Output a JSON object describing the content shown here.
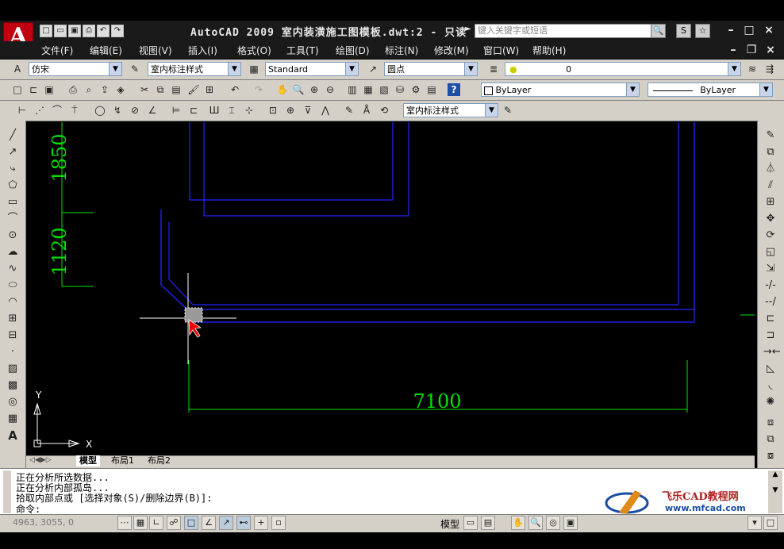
{
  "window": {
    "title": "AutoCAD 2009 室内装潢施工图模板.dwt:2 - 只读",
    "search_placeholder": "键入关键字或短语",
    "logo": "A"
  },
  "menu": [
    "文件(F)",
    "编辑(E)",
    "视图(V)",
    "插入(I)",
    "格式(O)",
    "工具(T)",
    "绘图(D)",
    "标注(N)",
    "修改(M)",
    "窗口(W)",
    "帮助(H)"
  ],
  "toolbar_row1": {
    "text_style": "仿宋",
    "dim_style": "室内标注样式",
    "table_style": "Standard",
    "multileader_style": "圆点",
    "layer": "0"
  },
  "toolbar_row2": {
    "color": "ByLayer",
    "linetype": "ByLayer"
  },
  "toolbar_row3": {
    "dim_style": "室内标注样式"
  },
  "drawing": {
    "dims": [
      "1850",
      "1120",
      "7100"
    ],
    "ucs_x": "X",
    "ucs_y": "Y",
    "colors": {
      "wall": "#1c1cff",
      "dim": "#00e000",
      "crosshair": "#ffffff"
    }
  },
  "layout_tabs": [
    "模型",
    "布局1",
    "布局2"
  ],
  "command": {
    "lines": [
      "正在分析所选数据...",
      "正在分析内部孤岛...",
      "拾取内部点或 [选择对象(S)/删除边界(B)]:",
      "命令:"
    ]
  },
  "status": {
    "coords": "4963, 3055, 0",
    "model_label": "模型"
  },
  "watermark": {
    "title": "飞乐CAD教程网",
    "url": "www.mfcad.com"
  }
}
